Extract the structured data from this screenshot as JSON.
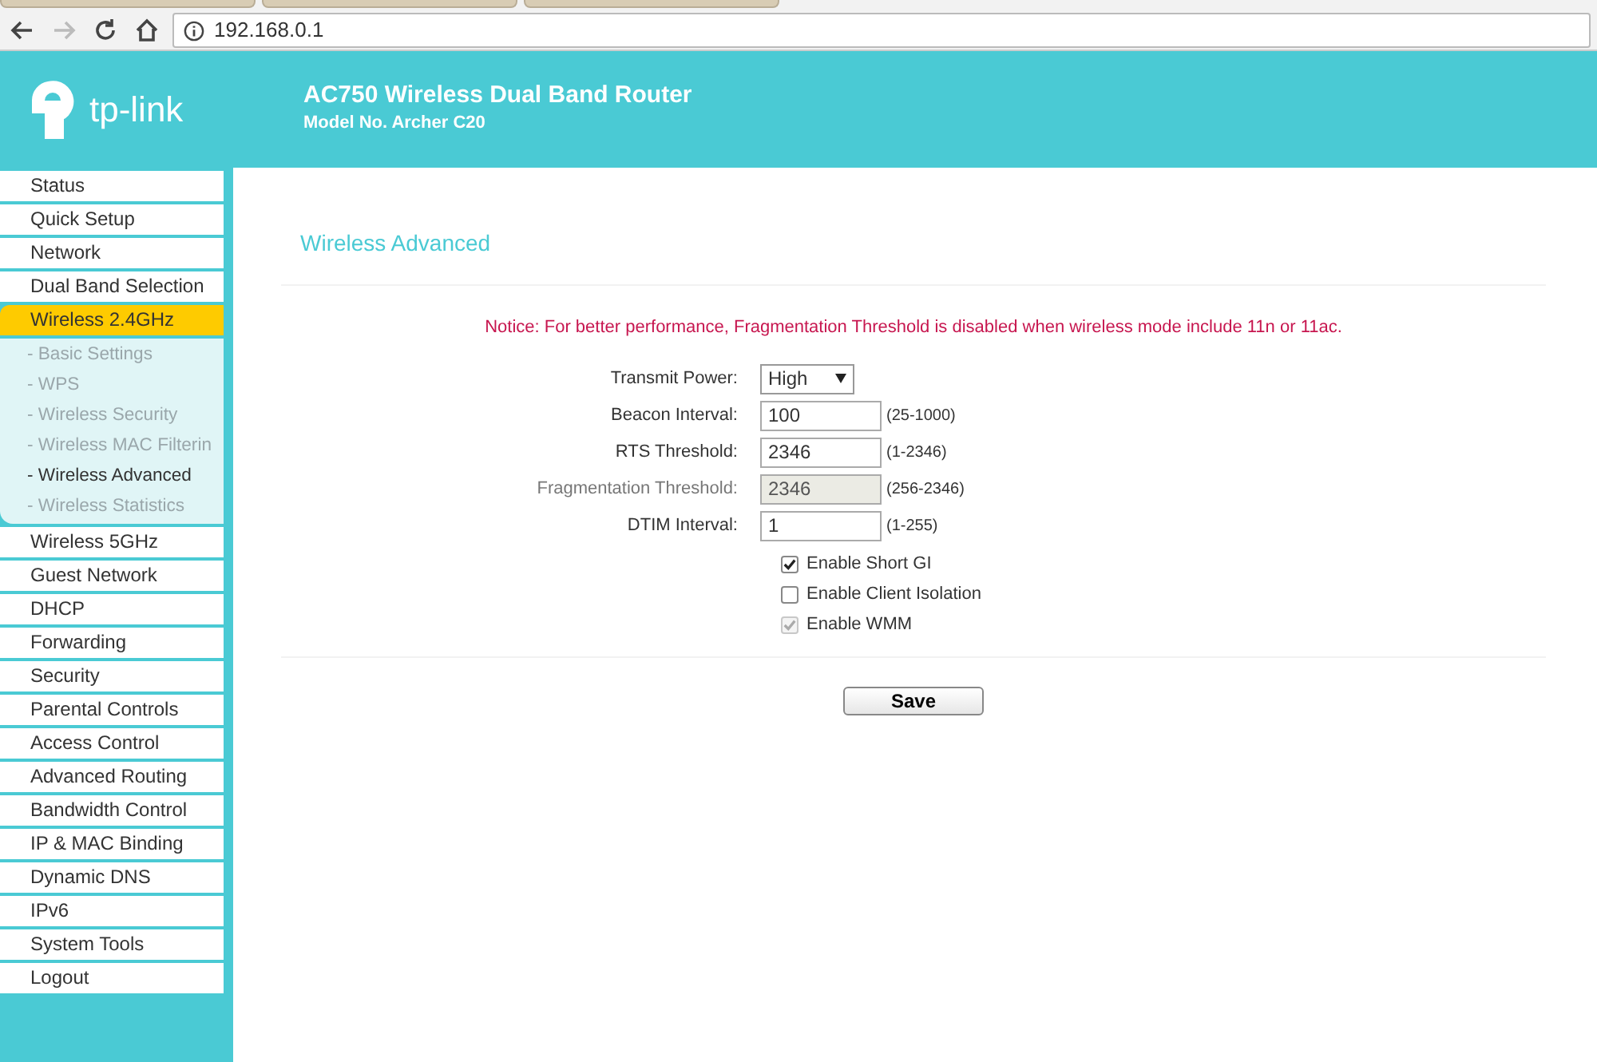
{
  "browser": {
    "url": "192.168.0.1",
    "back_disabled": false,
    "forward_disabled": true
  },
  "header": {
    "logo_text": "tp-link",
    "title": "AC750 Wireless Dual Band Router",
    "model": "Model No. Archer C20"
  },
  "sidebar": {
    "items": [
      {
        "label": "Status",
        "selected": false
      },
      {
        "label": "Quick Setup",
        "selected": false
      },
      {
        "label": "Network",
        "selected": false
      },
      {
        "label": "Dual Band Selection",
        "selected": false
      },
      {
        "label": "Wireless 2.4GHz",
        "selected": true,
        "children": [
          {
            "label": "- Basic Settings",
            "selected": false
          },
          {
            "label": "- WPS",
            "selected": false
          },
          {
            "label": "- Wireless Security",
            "selected": false
          },
          {
            "label": "- Wireless MAC Filterin",
            "selected": false
          },
          {
            "label": "- Wireless Advanced",
            "selected": true
          },
          {
            "label": "- Wireless Statistics",
            "selected": false
          }
        ]
      },
      {
        "label": "Wireless 5GHz",
        "selected": false
      },
      {
        "label": "Guest Network",
        "selected": false
      },
      {
        "label": "DHCP",
        "selected": false
      },
      {
        "label": "Forwarding",
        "selected": false
      },
      {
        "label": "Security",
        "selected": false
      },
      {
        "label": "Parental Controls",
        "selected": false
      },
      {
        "label": "Access Control",
        "selected": false
      },
      {
        "label": "Advanced Routing",
        "selected": false
      },
      {
        "label": "Bandwidth Control",
        "selected": false
      },
      {
        "label": "IP & MAC Binding",
        "selected": false
      },
      {
        "label": "Dynamic DNS",
        "selected": false
      },
      {
        "label": "IPv6",
        "selected": false
      },
      {
        "label": "System Tools",
        "selected": false
      },
      {
        "label": "Logout",
        "selected": false
      }
    ]
  },
  "page": {
    "title": "Wireless Advanced",
    "notice": "Notice: For better performance, Fragmentation Threshold is disabled when wireless mode include 11n or 11ac.",
    "fields": [
      {
        "kind": "select",
        "label": "Transmit Power:",
        "value": "High",
        "disabled": false
      },
      {
        "kind": "text",
        "label": "Beacon Interval:",
        "value": "100",
        "hint": "(25-1000)",
        "disabled": false
      },
      {
        "kind": "text",
        "label": "RTS Threshold:",
        "value": "2346",
        "hint": "(1-2346)",
        "disabled": false
      },
      {
        "kind": "text",
        "label": "Fragmentation Threshold:",
        "value": "2346",
        "hint": "(256-2346)",
        "disabled": true
      },
      {
        "kind": "text",
        "label": "DTIM Interval:",
        "value": "1",
        "hint": "(1-255)",
        "disabled": false
      }
    ],
    "checkboxes": [
      {
        "label": "Enable Short GI",
        "checked": true,
        "disabled": false
      },
      {
        "label": "Enable Client Isolation",
        "checked": false,
        "disabled": false
      },
      {
        "label": "Enable WMM",
        "checked": true,
        "disabled": true
      }
    ],
    "save_button": "Save"
  }
}
